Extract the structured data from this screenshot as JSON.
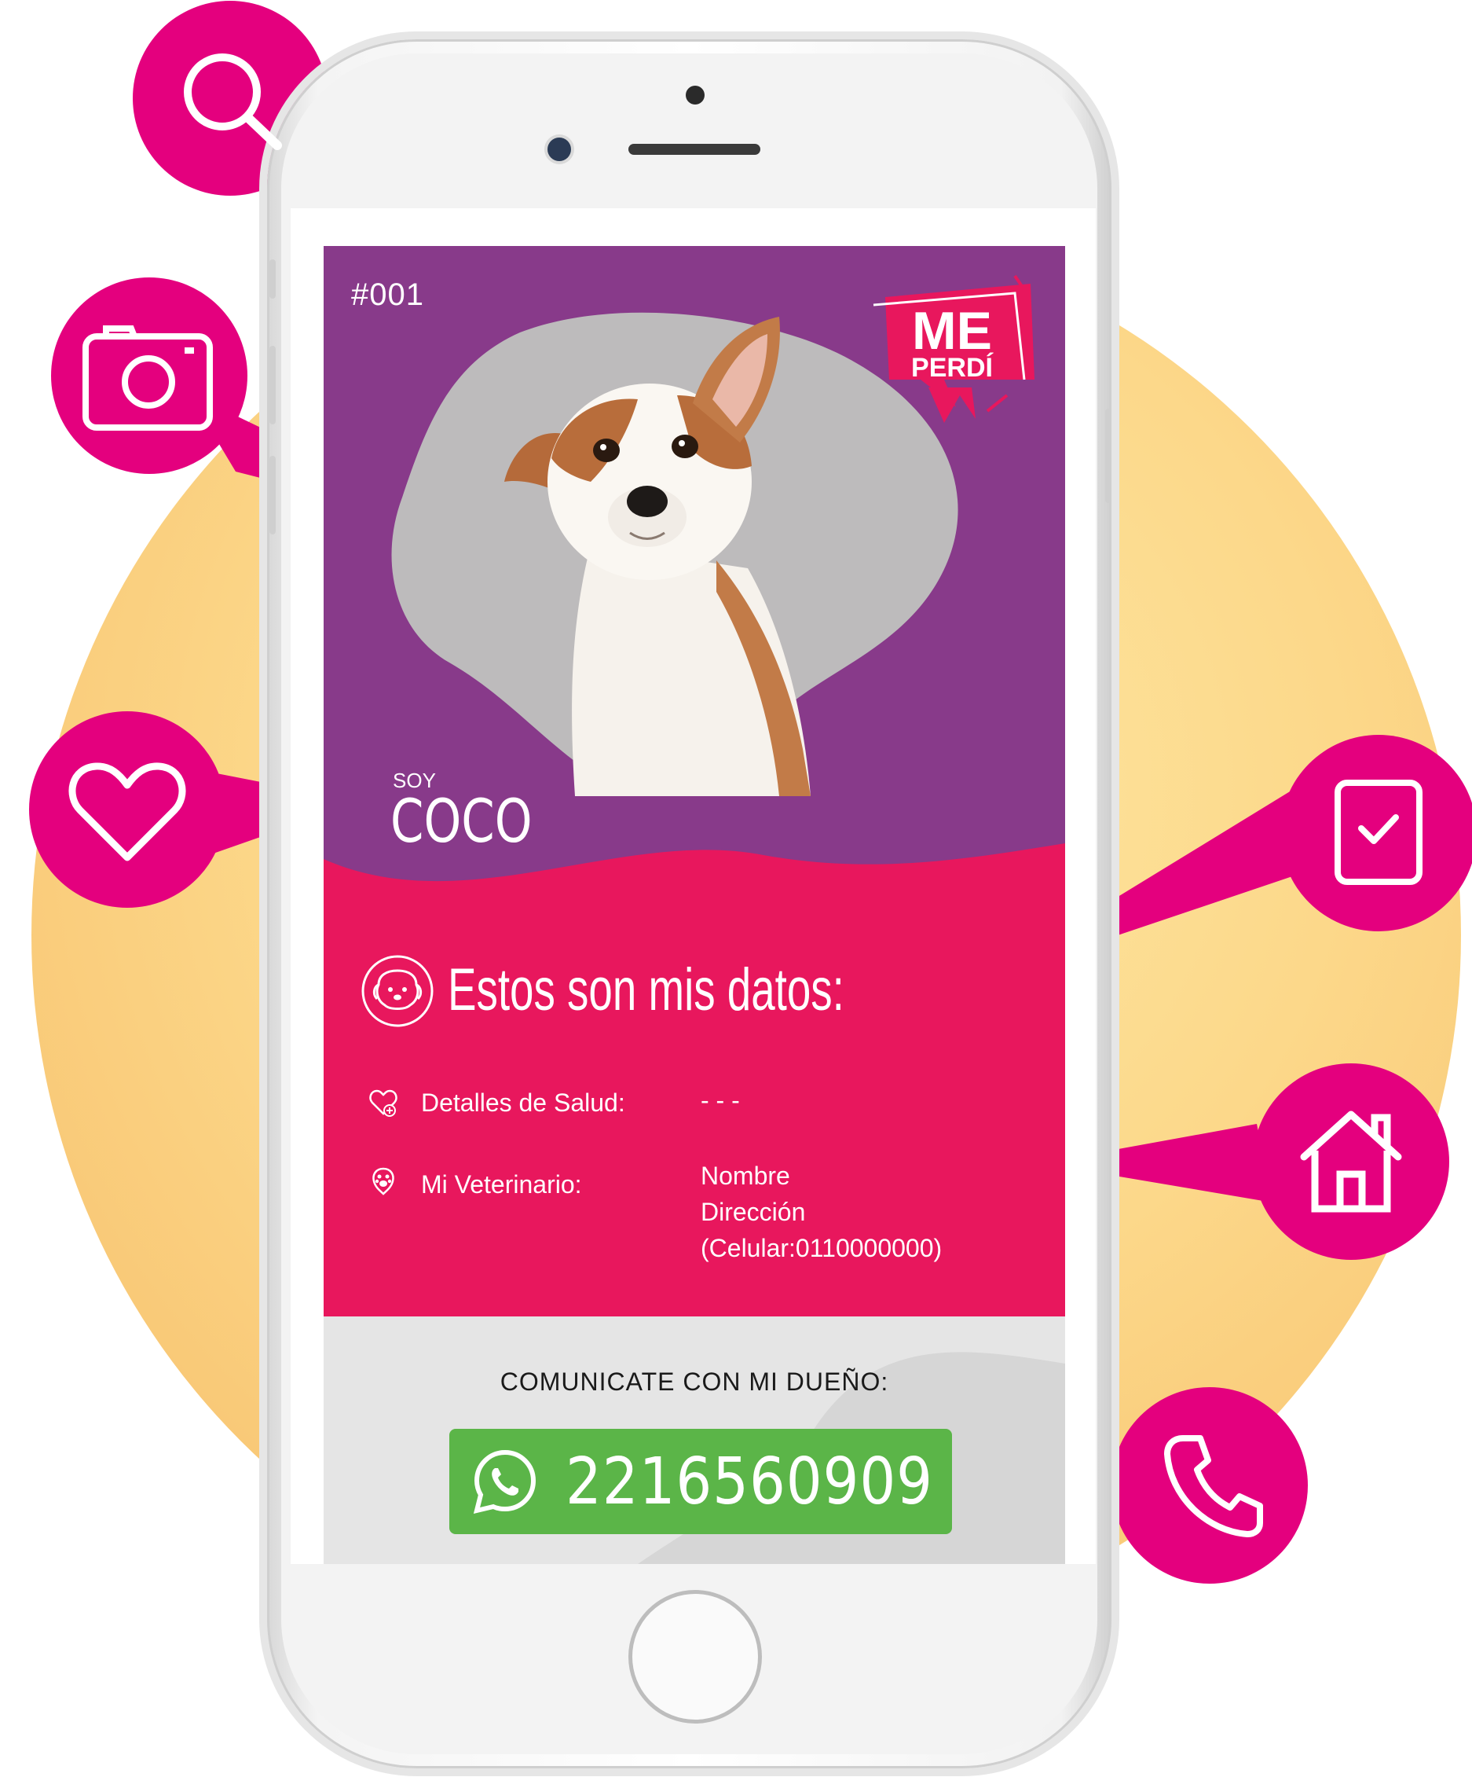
{
  "card": {
    "number": "#001",
    "badge_top": "ME",
    "badge_bottom": "PERDÍ",
    "intro": "SOY",
    "pet_name": "COCO"
  },
  "details": {
    "title": "Estos son mis datos:",
    "health_label": "Detalles de Salud:",
    "health_value": "- - -",
    "vet_label": "Mi Veterinario:",
    "vet_name": "Nombre",
    "vet_address": "Dirección",
    "vet_phone": "(Celular:0110000000)"
  },
  "contact": {
    "label": "COMUNICATE CON MI DUEÑO:",
    "whatsapp_number": "2216560909"
  },
  "callouts": [
    "search-icon",
    "camera-icon",
    "heart-icon",
    "clipboard-check-icon",
    "home-icon",
    "phone-icon"
  ],
  "colors": {
    "purple": "#883A8A",
    "pink": "#E8175D",
    "magenta": "#E4007E",
    "whatsapp_green": "#5BB548",
    "background_circle": "#FCD88A"
  }
}
